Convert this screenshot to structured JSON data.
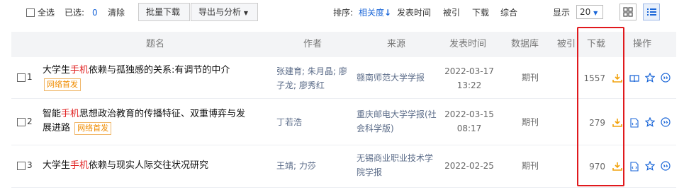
{
  "toolbar": {
    "select_all": "全选",
    "selected_label": "已选:",
    "selected_count": "0",
    "clear": "清除",
    "batch_download": "批量下载",
    "export_analysis": "导出与分析",
    "sort_label": "排序:",
    "sort_relevance": "相关度",
    "sort_options": [
      "发表时间",
      "被引",
      "下载",
      "综合"
    ],
    "display_label": "显示",
    "page_size": "20"
  },
  "columns": [
    "题名",
    "作者",
    "来源",
    "发表时间",
    "数据库",
    "被引",
    "下载",
    "操作"
  ],
  "rows": [
    {
      "num": "1",
      "title_pre": "大学生",
      "title_hl": "手机",
      "title_post": "依赖与孤独感的关系:有调节的中介",
      "title_line2_pre": "",
      "tag": "网络首发",
      "author_line1": "张建育; 朱月晶; 廖",
      "author_line2": "子龙; 廖秀红",
      "source_line1": "赣南师范大学学报",
      "source_line2": "",
      "date_line1": "2022-03-17",
      "date_line2": "13:22",
      "db": "期刊",
      "downloads": "1557"
    },
    {
      "num": "2",
      "title_pre": "智能",
      "title_hl": "手机",
      "title_post": "思想政治教育的传播特征、双重博弈与发",
      "title_line2_pre": "展进路",
      "tag": "网络首发",
      "author_line1": "丁若浩",
      "author_line2": "",
      "source_line1": "重庆邮电大学学报(社",
      "source_line2": "会科学版)",
      "date_line1": "2022-03-15",
      "date_line2": "08:17",
      "db": "期刊",
      "downloads": "279"
    },
    {
      "num": "3",
      "title_pre": "大学生",
      "title_hl": "手机",
      "title_post": "依赖与现实人际交往状况研究",
      "title_line2_pre": "",
      "tag": "",
      "author_line1": "王靖; 力莎",
      "author_line2": "",
      "source_line1": "无锡商业职业技术学",
      "source_line2": "院学报",
      "date_line1": "2022-02-25",
      "date_line2": "",
      "db": "期刊",
      "downloads": "970"
    }
  ],
  "colors": {
    "accent_blue": "#1a66d8",
    "highlight_red": "#e02020",
    "tag_orange": "#f08c00",
    "download_icon": "#f2a20c",
    "red_box": "#e0191d"
  },
  "icons": [
    "checkbox",
    "sort-down-arrow-icon",
    "grid-view-icon",
    "list-view-icon",
    "download-icon",
    "read-book-icon",
    "html-read-icon",
    "favorite-star-icon",
    "quote-icon"
  ]
}
